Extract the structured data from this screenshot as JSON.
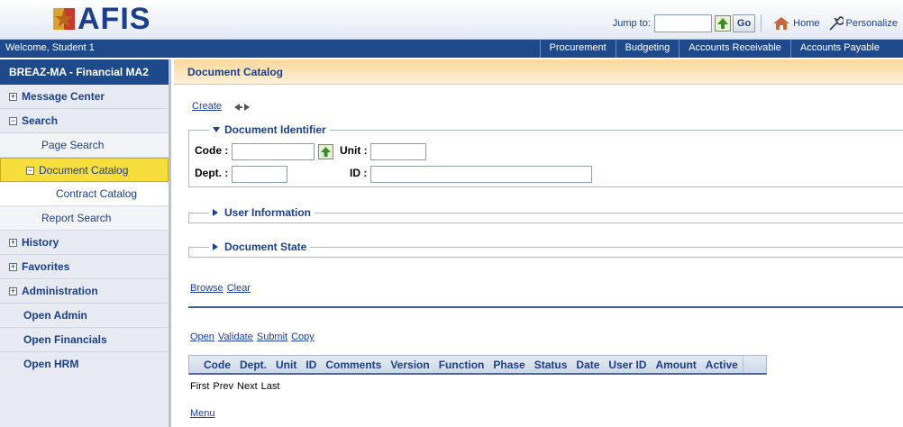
{
  "header": {
    "logo_text": "AFIS",
    "jump_label": "Jump to:",
    "jump_value": "",
    "go_label": "Go",
    "home_label": "Home",
    "personalize_label": "Personalize"
  },
  "navbar": {
    "welcome": "Welcome, Student 1",
    "items": [
      "Procurement",
      "Budgeting",
      "Accounts Receivable",
      "Accounts Payable"
    ]
  },
  "sidebar": {
    "title": "BREAZ-MA - Financial MA2",
    "message_center": "Message Center",
    "search": "Search",
    "page_search": "Page Search",
    "document_catalog": "Document Catalog",
    "contract_catalog": "Contract Catalog",
    "report_search": "Report Search",
    "history": "History",
    "favorites": "Favorites",
    "administration": "Administration",
    "open_admin": "Open Admin",
    "open_financials": "Open Financials",
    "open_hrm": "Open HRM",
    "expand_glyph": "+",
    "collapse_glyph": "−"
  },
  "main": {
    "title": "Document Catalog",
    "create_link": "Create",
    "doc_identifier": {
      "legend": "Document Identifier",
      "code_label": "Code :",
      "code_value": "",
      "unit_label": "Unit :",
      "unit_value": "",
      "dept_label": "Dept. :",
      "dept_value": "",
      "id_label": "ID :",
      "id_value": ""
    },
    "user_info_legend": "User Information",
    "doc_state_legend": "Document State",
    "browse_link": "Browse",
    "clear_link": "Clear",
    "actions": {
      "open": "Open",
      "validate": "Validate",
      "submit": "Submit",
      "copy": "Copy"
    },
    "table_columns": [
      "Code",
      "Dept.",
      "Unit",
      "ID",
      "Comments",
      "Version",
      "Function",
      "Phase",
      "Status",
      "Date",
      "User ID",
      "Amount",
      "Active"
    ],
    "pager": {
      "first": "First",
      "prev": "Prev",
      "next": "Next",
      "last": "Last"
    },
    "menu_link": "Menu"
  },
  "colors": {
    "nav_blue": "#1e4a8c",
    "selected_yellow": "#f7de3c",
    "title_orange": "#fbd79a"
  }
}
